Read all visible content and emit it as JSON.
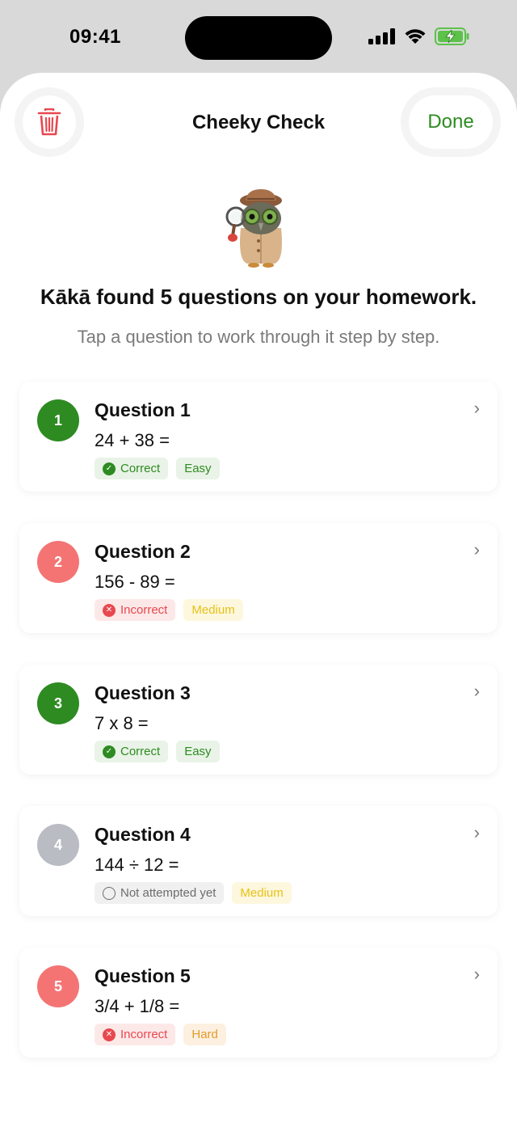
{
  "status": {
    "time": "09:41",
    "icons": [
      "signal-icon",
      "wifi-icon",
      "battery-charging-icon"
    ]
  },
  "header": {
    "title": "Cheeky Check",
    "done_label": "Done",
    "trash_icon": "trash-icon"
  },
  "intro": {
    "headline": "Kākā found 5 questions on your homework.",
    "subline": "Tap a question to work through it step by step."
  },
  "colors": {
    "correct": "#2e8b22",
    "incorrect": "#f47474",
    "not_attempted": "#b9bcc3",
    "easy": "#2e8b22",
    "medium": "#e6c217",
    "hard": "#e39a2a"
  },
  "questions": [
    {
      "number": "1",
      "title": "Question 1",
      "expression": "24 + 38 =",
      "status": "Correct",
      "difficulty": "Easy"
    },
    {
      "number": "2",
      "title": "Question 2",
      "expression": "156 - 89 =",
      "status": "Incorrect",
      "difficulty": "Medium"
    },
    {
      "number": "3",
      "title": "Question 3",
      "expression": "7 x 8 =",
      "status": "Correct",
      "difficulty": "Easy"
    },
    {
      "number": "4",
      "title": "Question 4",
      "expression": "144 ÷ 12 =",
      "status": "Not attempted yet",
      "difficulty": "Medium"
    },
    {
      "number": "5",
      "title": "Question 5",
      "expression": "3/4 + 1/8 =",
      "status": "Incorrect",
      "difficulty": "Hard"
    }
  ]
}
